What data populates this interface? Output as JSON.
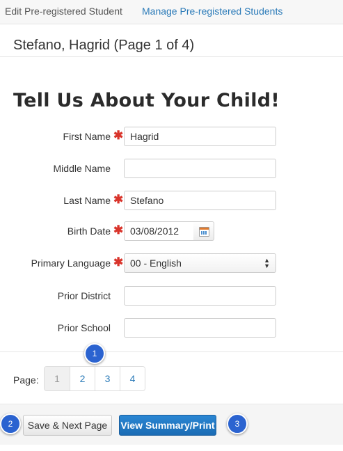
{
  "tabs": {
    "active": "Edit Pre-registered Student",
    "link": "Manage Pre-registered Students"
  },
  "page_title": "Stefano, Hagrid (Page 1 of 4)",
  "form": {
    "heading": "Tell Us About Your Child!",
    "required_mark": "✱",
    "fields": {
      "first_name": {
        "label": "First Name",
        "value": "Hagrid",
        "required": true
      },
      "middle_name": {
        "label": "Middle Name",
        "value": "",
        "required": false
      },
      "last_name": {
        "label": "Last Name",
        "value": "Stefano",
        "required": true
      },
      "birth_date": {
        "label": "Birth Date",
        "value": "03/08/2012",
        "required": true
      },
      "primary_language": {
        "label": "Primary Language",
        "value": "00 - English",
        "required": true
      },
      "prior_district": {
        "label": "Prior District",
        "value": "",
        "required": false
      },
      "prior_school": {
        "label": "Prior School",
        "value": "",
        "required": false
      }
    }
  },
  "pagination": {
    "label": "Page:",
    "pages": [
      "1",
      "2",
      "3",
      "4"
    ],
    "current": "1"
  },
  "footer": {
    "save_label": "Save & Next Page",
    "view_label": "View Summary/Print"
  },
  "callouts": [
    "1",
    "2",
    "3"
  ],
  "colors": {
    "link": "#2a7ab8",
    "required": "#d9342b",
    "primary_button": "#1b6cb4",
    "callout": "#2b63d0"
  }
}
